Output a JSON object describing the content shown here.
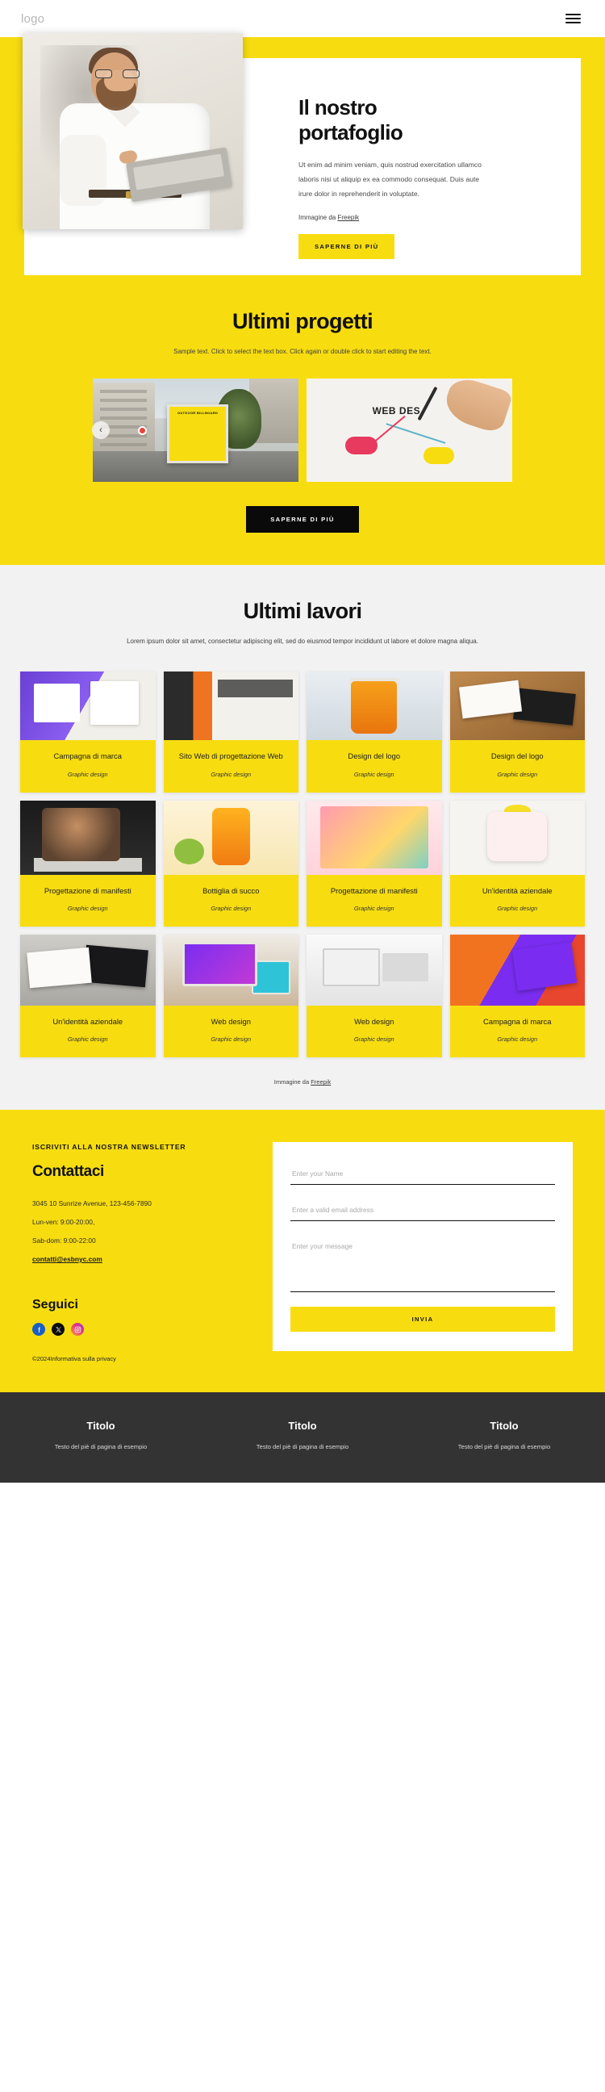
{
  "header": {
    "logo": "logo",
    "menu_icon": "hamburger-icon"
  },
  "hero": {
    "title": "Il nostro portafoglio",
    "paragraph": "Ut enim ad minim veniam, quis nostrud exercitation ullamco laboris nisi ut aliquip ex ea commodo consequat. Duis aute irure dolor in reprehenderit in voluptate.",
    "credit_prefix": "Immagine da ",
    "credit_link": "Freepik",
    "cta": "SAPERNE DI PIÙ",
    "image_alt": "Uomo d'affari con laptop"
  },
  "projects": {
    "title": "Ultimi progetti",
    "subtitle": "Sample text. Click to select the text box. Click again or double click to start editing the text.",
    "prev_arrow": "‹",
    "slides": [
      {
        "name": "outdoor-billboard",
        "caption": "OUTDOOR BILLBOARD"
      },
      {
        "name": "web-design-mindmap",
        "caption": "WEB DES"
      }
    ],
    "cta": "SAPERNE DI PIÙ"
  },
  "works": {
    "title": "Ultimi lavori",
    "subtitle": "Lorem ipsum dolor sit amet, consectetur adipiscing elit, sed do eiusmod tempor incididunt ut labore et dolore magna aliqua.",
    "credit_prefix": "Immagine da ",
    "credit_link": "Freepik",
    "category_label": "Graphic design",
    "items": [
      {
        "title": "Campagna di marca",
        "category": "Graphic design",
        "art": "a-bookcover"
      },
      {
        "title": "Sito Web di progettazione Web",
        "category": "Graphic design",
        "art": "a-magazine"
      },
      {
        "title": "Design del logo",
        "category": "Graphic design",
        "art": "a-cup"
      },
      {
        "title": "Design del logo",
        "category": "Graphic design",
        "art": "a-cards"
      },
      {
        "title": "Progettazione di manifesti",
        "category": "Graphic design",
        "art": "a-poster"
      },
      {
        "title": "Bottiglia di succo",
        "category": "Graphic design",
        "art": "a-juice"
      },
      {
        "title": "Progettazione di manifesti",
        "category": "Graphic design",
        "art": "a-festival"
      },
      {
        "title": "Un'identità aziendale",
        "category": "Graphic design",
        "art": "a-identity"
      },
      {
        "title": "Un'identità aziendale",
        "category": "Graphic design",
        "art": "a-bizcard"
      },
      {
        "title": "Web design",
        "category": "Graphic design",
        "art": "a-imac"
      },
      {
        "title": "Web design",
        "category": "Graphic design",
        "art": "a-desk"
      },
      {
        "title": "Campagna di marca",
        "category": "Graphic design",
        "art": "a-colors"
      }
    ]
  },
  "contact": {
    "newsletter_label": "ISCRIVITI ALLA NOSTRA NEWSLETTER",
    "title": "Contattaci",
    "address": "3045 10 Sunrize Avenue, 123-456-7890",
    "hours_weekday": "Lun-ven: 9:00-20:00,",
    "hours_weekend": "Sab-dom: 9:00-22:00",
    "email": "contatti@esbnyc.com",
    "follow_title": "Seguici",
    "socials": [
      {
        "name": "facebook-icon",
        "label": "Facebook"
      },
      {
        "name": "x-twitter-icon",
        "label": "X"
      },
      {
        "name": "instagram-icon",
        "label": "Instagram"
      }
    ],
    "copyright": "©2024Informativa sulla privacy",
    "form": {
      "name_placeholder": "Enter your Name",
      "name_value": "",
      "email_placeholder": "Enter a valid email address",
      "email_value": "",
      "message_placeholder": "Enter your message",
      "message_value": "",
      "submit": "INVIA"
    }
  },
  "footer": {
    "columns": [
      {
        "title": "Titolo",
        "text": "Testo del piè di pagina di esempio"
      },
      {
        "title": "Titolo",
        "text": "Testo del piè di pagina di esempio"
      },
      {
        "title": "Titolo",
        "text": "Testo del piè di pagina di esempio"
      }
    ]
  },
  "colors": {
    "brand_yellow": "#f7dd10",
    "dark": "#111111",
    "footer_bg": "#333333",
    "works_bg": "#f2f2f2"
  }
}
